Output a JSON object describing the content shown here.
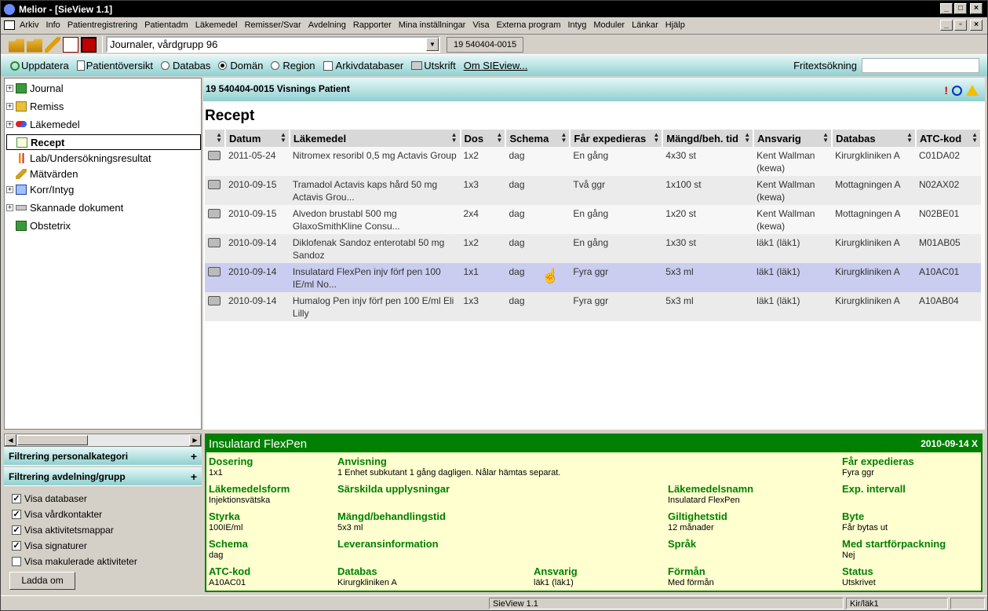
{
  "window": {
    "title": "Melior - [SieView 1.1]"
  },
  "menu": [
    "Arkiv",
    "Info",
    "Patientregistrering",
    "Patientadm",
    "Läkemedel",
    "Remisser/Svar",
    "Avdelning",
    "Rapporter",
    "Mina inställningar",
    "Visa",
    "Externa program",
    "Intyg",
    "Moduler",
    "Länkar",
    "Hjälp"
  ],
  "toolbar": {
    "journal_select": "Journaler, vårdgrupp 96",
    "patient_id": "19 540404-0015"
  },
  "options": {
    "update": "Uppdatera",
    "overview": "Patientöversikt",
    "radio_database": "Databas",
    "radio_domain": "Domän",
    "radio_region": "Region",
    "archive": "Arkivdatabaser",
    "print": "Utskrift",
    "about": "Om SIEview...",
    "freetext_label": "Fritextsökning",
    "freetext_value": ""
  },
  "tree": [
    {
      "label": "Journal",
      "icon": "journal-icon",
      "expand": true
    },
    {
      "label": "Remiss",
      "icon": "folder-icon",
      "expand": true
    },
    {
      "label": "Läkemedel",
      "icon": "pill-icon",
      "expand": true
    },
    {
      "label": "Recept",
      "icon": "prescription-icon",
      "expand": false,
      "selected": true
    },
    {
      "label": "Lab/Undersökningsresultat",
      "icon": "lab-icon",
      "expand": false
    },
    {
      "label": "Mätvärden",
      "icon": "ruler-icon",
      "expand": false
    },
    {
      "label": "Korr/Intyg",
      "icon": "certificate-icon",
      "expand": true
    },
    {
      "label": "Skannade dokument",
      "icon": "scanner-icon",
      "expand": true
    },
    {
      "label": "Obstetrix",
      "icon": "journal-icon",
      "expand": false
    }
  ],
  "filters": {
    "personal": "Filtrering personalkategori",
    "department": "Filtrering avdelning/grupp",
    "checks": [
      {
        "label": "Visa databaser",
        "checked": true
      },
      {
        "label": "Visa vårdkontakter",
        "checked": true
      },
      {
        "label": "Visa aktivitetsmappar",
        "checked": true
      },
      {
        "label": "Visa signaturer",
        "checked": true
      },
      {
        "label": "Visa makulerade aktiviteter",
        "checked": false
      }
    ],
    "reload": "Ladda om"
  },
  "patient": {
    "header": "19 540404-0015 Visnings Patient"
  },
  "page": {
    "title": "Recept"
  },
  "table": {
    "columns": [
      "Datum",
      "Läkemedel",
      "Dos",
      "Schema",
      "Får expedieras",
      "Mängd/beh. tid",
      "Ansvarig",
      "Databas",
      "ATC-kod"
    ],
    "rows": [
      [
        "2011-05-24",
        "Nitromex resoribl 0,5 mg Actavis Group",
        "1x2",
        "dag",
        "En gång",
        "4x30 st",
        "Kent Wallman (kewa)",
        "Kirurgkliniken A",
        "C01DA02"
      ],
      [
        "2010-09-15",
        "Tramadol Actavis kaps hård 50 mg Actavis Grou...",
        "1x3",
        "dag",
        "Två ggr",
        "1x100 st",
        "Kent Wallman (kewa)",
        "Mottagningen A",
        "N02AX02"
      ],
      [
        "2010-09-15",
        "Alvedon brustabl 500 mg GlaxoSmithKline Consu...",
        "2x4",
        "dag",
        "En gång",
        "1x20 st",
        "Kent Wallman (kewa)",
        "Mottagningen A",
        "N02BE01"
      ],
      [
        "2010-09-14",
        "Diklofenak Sandoz enterotabl 50 mg Sandoz",
        "1x2",
        "dag",
        "En gång",
        "1x30 st",
        "läk1 (läk1)",
        "Kirurgkliniken A",
        "M01AB05"
      ],
      [
        "2010-09-14",
        "Insulatard FlexPen injv förf pen 100 IE/ml No...",
        "1x1",
        "dag",
        "Fyra ggr",
        "5x3 ml",
        "läk1 (läk1)",
        "Kirurgkliniken A",
        "A10AC01"
      ],
      [
        "2010-09-14",
        "Humalog Pen injv förf pen 100 E/ml Eli Lilly",
        "1x3",
        "dag",
        "Fyra ggr",
        "5x3 ml",
        "läk1 (läk1)",
        "Kirurgkliniken A",
        "A10AB04"
      ]
    ],
    "highlighted_row": 4
  },
  "detail": {
    "title": "Insulatard FlexPen",
    "date": "2010-09-14",
    "close": "X",
    "fields": {
      "dosering": {
        "label": "Dosering",
        "value": "1x1"
      },
      "anvisning": {
        "label": "Anvisning",
        "value": "1 Enhet subkutant 1 gång dagligen. Nålar hämtas separat."
      },
      "far_exp": {
        "label": "Får expedieras",
        "value": "Fyra ggr"
      },
      "form": {
        "label": "Läkemedelsform",
        "value": "Injektionsvätska"
      },
      "sarskilda": {
        "label": "Särskilda upplysningar",
        "value": ""
      },
      "namn": {
        "label": "Läkemedelsnamn",
        "value": "Insulatard FlexPen"
      },
      "exp_int": {
        "label": "Exp. intervall",
        "value": ""
      },
      "styrka": {
        "label": "Styrka",
        "value": "100IE/ml"
      },
      "mangd": {
        "label": "Mängd/behandlingstid",
        "value": "5x3 ml"
      },
      "giltighet": {
        "label": "Giltighetstid",
        "value": "12 månader"
      },
      "byte": {
        "label": "Byte",
        "value": "Får bytas ut"
      },
      "schema": {
        "label": "Schema",
        "value": "dag"
      },
      "leverans": {
        "label": "Leveransinformation",
        "value": ""
      },
      "sprak": {
        "label": "Språk",
        "value": ""
      },
      "startforp": {
        "label": "Med startförpackning",
        "value": "Nej"
      },
      "atc": {
        "label": "ATC-kod",
        "value": "A10AC01"
      },
      "databas": {
        "label": "Databas",
        "value": "Kirurgkliniken A"
      },
      "ansvarig": {
        "label": "Ansvarig",
        "value": "läk1 (läk1)"
      },
      "forman": {
        "label": "Förmån",
        "value": "Med förmån"
      },
      "status": {
        "label": "Status",
        "value": "Utskrivet"
      }
    }
  },
  "statusbar": {
    "app": "SieView 1.1",
    "user": "Kir/läk1"
  }
}
